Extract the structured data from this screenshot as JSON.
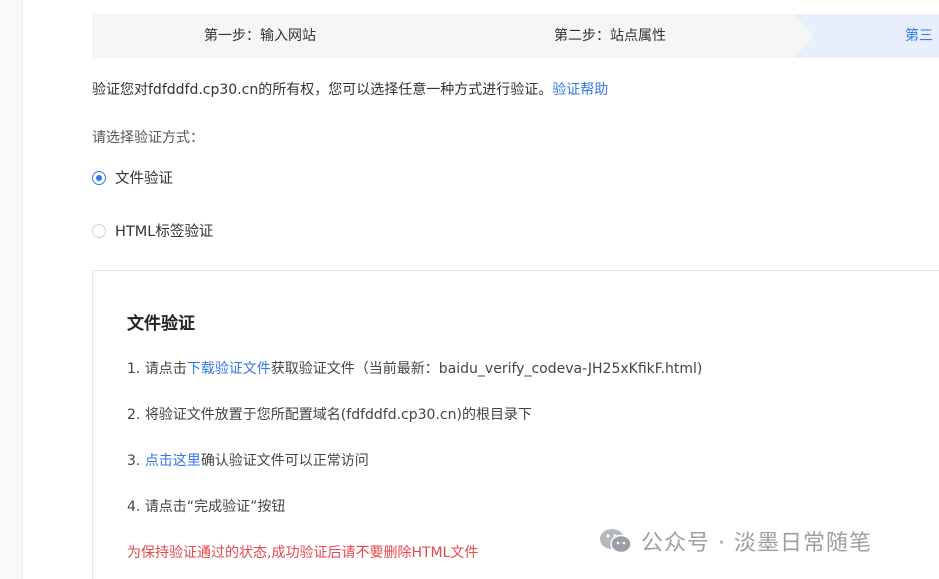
{
  "steps": [
    {
      "label": "第一步：输入网站"
    },
    {
      "label": "第二步：站点属性"
    },
    {
      "label": "第三步"
    }
  ],
  "intro": {
    "text": "验证您对fdfddfd.cp30.cn的所有权，您可以选择任意一种方式进行验证。",
    "help_link": "验证帮助"
  },
  "method_prompt": "请选择验证方式：",
  "methods": [
    {
      "label": "文件验证",
      "selected": true
    },
    {
      "label": "HTML标签验证",
      "selected": false
    }
  ],
  "panel": {
    "title": "文件验证",
    "step1": {
      "num": "1.",
      "prefix": "请点击",
      "link": "下载验证文件",
      "suffix": "获取验证文件（当前最新：baidu_verify_codeva-JH25xKfikF.html)"
    },
    "step2": {
      "num": "2.",
      "text": "将验证文件放置于您所配置域名(fdfddfd.cp30.cn)的根目录下"
    },
    "step3": {
      "num": "3.",
      "link": "点击这里",
      "suffix": "确认验证文件可以正常访问"
    },
    "step4": {
      "num": "4.",
      "text": "请点击“完成验证”按钮"
    },
    "warning": "为保持验证通过的状态,成功验证后请不要删除HTML文件"
  },
  "watermark": {
    "text": "公众号 · 淡墨日常随笔",
    "icon": "wechat-icon"
  },
  "colors": {
    "link": "#3478e5",
    "warning": "#e5484d",
    "active_step_bg": "#e6effb"
  }
}
